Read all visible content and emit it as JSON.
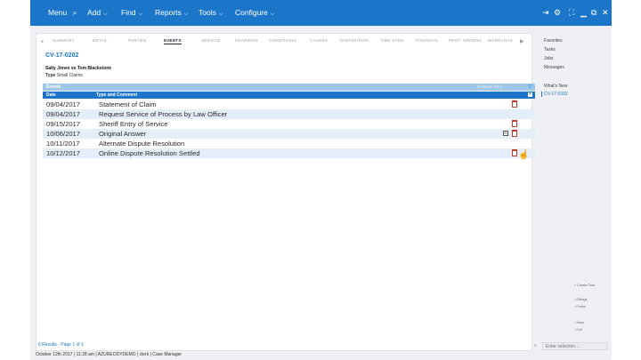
{
  "topbar": {
    "menu_label": "Menu",
    "add_label": "Add",
    "find_label": "Find",
    "reports_label": "Reports",
    "tools_label": "Tools",
    "configure_label": "Configure",
    "icons": [
      "search-icon",
      "login-icon",
      "gear-icon",
      "expand-icon",
      "minimize-icon",
      "restore-icon",
      "close-icon"
    ]
  },
  "tabs": [
    {
      "label": "SUMMARY",
      "active": false
    },
    {
      "label": "DETAIL",
      "active": false
    },
    {
      "label": "PARTIES",
      "active": false
    },
    {
      "label": "EVENTS",
      "active": true
    },
    {
      "label": "SERVICE",
      "active": false
    },
    {
      "label": "HEARINGS",
      "active": false
    },
    {
      "label": "CONDITIONS",
      "active": false
    },
    {
      "label": "CAUSES",
      "active": false
    },
    {
      "label": "DISPOSITION",
      "active": false
    },
    {
      "label": "TIME STDS",
      "active": false
    },
    {
      "label": "FINANCIAL",
      "active": false
    },
    {
      "label": "PROT. ORDERS",
      "active": false
    },
    {
      "label": "WARRANTS",
      "active": false
    }
  ],
  "case": {
    "number": "CV-17-0202",
    "title": "Sally Jones vs Tom Blackstone",
    "type_label": "Type",
    "type_value": "Small Claims"
  },
  "events": {
    "header": "Events",
    "tools": "Collapse   Print",
    "columns": {
      "date": "Date",
      "type": "Type and Comment"
    },
    "rows": [
      {
        "date": "09/04/2017",
        "desc": "Statement of Claim",
        "doc": true,
        "hist": false
      },
      {
        "date": "09/04/2017",
        "desc": "Request Service of Process by Law Officer",
        "doc": false,
        "hist": false
      },
      {
        "date": "09/15/2017",
        "desc": "Sheriff Entry of Service",
        "doc": true,
        "hist": false
      },
      {
        "date": "10/06/2017",
        "desc": "Original Answer",
        "doc": true,
        "hist": true
      },
      {
        "date": "10/11/2017",
        "desc": "Alternate Dispute Resolution",
        "doc": false,
        "hist": false
      },
      {
        "date": "10/12/2017",
        "desc": "Online Dispute Resolution Settled",
        "doc": true,
        "hist": false
      }
    ]
  },
  "results": "6 Results - Page 1 of 1",
  "sidebar": {
    "links": [
      "Favorites",
      "Tasks",
      "Jobs",
      "Messages"
    ],
    "whats_new": "What's New",
    "whats_new_item": "CV-17-0202",
    "actions": [
      "Create Task",
      "Efilings",
      "Forms",
      "Save",
      "Exit"
    ],
    "select_placeholder": "Enter selection..."
  },
  "status": {
    "text": "October 12th 2017  |  11:28 am  |  AZUREODYDEMO  |  clerk  |  Case Manager"
  },
  "colors": {
    "accent": "#1b75c9",
    "row_alt": "#e4eef8",
    "events_header": "#9fc7ea"
  }
}
